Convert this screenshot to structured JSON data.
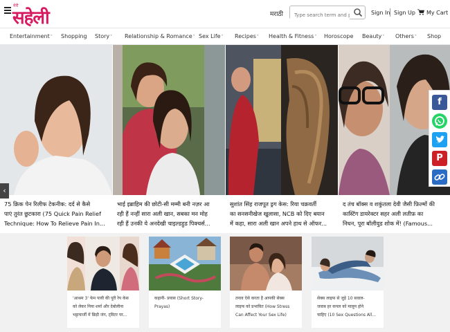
{
  "header": {
    "logo_small": "मेरी",
    "logo_main": "सहेली",
    "language": "मराठी",
    "search_placeholder": "Type search term and press enter",
    "sign_in": "Sign In",
    "sign_up": "Sign Up",
    "cart": "My Cart"
  },
  "nav": {
    "items": [
      {
        "label": "Entertainment",
        "dropdown": true
      },
      {
        "label": "Shopping",
        "dropdown": false
      },
      {
        "label": "Story",
        "dropdown": true
      },
      {
        "label": "Relationship & Romance",
        "dropdown": true
      },
      {
        "label": "Sex Life",
        "dropdown": true
      },
      {
        "label": "Recipes",
        "dropdown": true
      },
      {
        "label": "Health & Fitness",
        "dropdown": true
      },
      {
        "label": "Horoscope",
        "dropdown": false
      },
      {
        "label": "Beauty",
        "dropdown": true
      },
      {
        "label": "Others",
        "dropdown": true
      },
      {
        "label": "Shop",
        "dropdown": false
      }
    ]
  },
  "carousel": {
    "slides": [
      {
        "caption_line1": "75 क्रिक पेन रिलीफ टेकनीक: दर्द से कैसे",
        "caption_line2": "पाएं तुरंत छुटकारा (75 Quick Pain Relief",
        "caption_line3": "Technique: How To Relieve Pain In..."
      },
      {
        "caption_line1": "भाई इब्राहिम की छोटी-सी मम्मी बनी नज़र आ",
        "caption_line2": "रही हैं नन्हीं सारा अली खान, सबका मन मोह",
        "caption_line3": "रही हैं उनकी ये अनदेखी चाइल्डहुड पिक्चर्स..."
      },
      {
        "caption_line1": "सुशांत सिंह राजपूत ड्रग केस: रिया चक्रवर्ती",
        "caption_line2": "का सनसनीखेज खुलासा, NCB को दिए बयान",
        "caption_line3": "में कहा, सारा अली खान अपने हाथ से ऑफर..."
      },
      {
        "caption_line1": "द तंच बॉक्स व शकुंतला देवी जैसी फ़िल्मों की",
        "caption_line2": "कास्टिंग डायरेक्टर सहर अली लतीफ़ का",
        "caption_line3": "निधन, पूरा बॉलीवुड शोक में! (Famous..."
      }
    ],
    "prev_label": "‹"
  },
  "share": [
    "facebook-icon",
    "whatsapp-icon",
    "twitter-icon",
    "pinterest-icon",
    "link-icon"
  ],
  "colors": {
    "brand": "#d81b60",
    "facebook": "#3b5998",
    "whatsapp": "#25d366",
    "twitter": "#1da1f2",
    "pinterest": "#cb2027",
    "link": "#2a6cc4"
  },
  "cards": [
    {
      "line1": "'आश्रम 3' फेम पायी की पूरी रेप केस",
      "line2": "को लेकर निया शर्मा और देबोलीना",
      "line3": "भट्टाचार्जी में छिड़ी जंग, ट्विटर पर..."
    },
    {
      "line1": "कहानी- प्रयास (Short Story-",
      "line2": "Prayas)",
      "line3": ""
    },
    {
      "line1": "तनाव ऐसे करता है आपकी सेक्स",
      "line2": "लाइफ को प्रभावित (How Stress",
      "line3": "Can Affect Your Sex Life)"
    },
    {
      "line1": "सेक्स लाइफ से जुड़े 10 सवाल-",
      "line2": "जवाब हर कपल को मालूम होने",
      "line3": "चाहिए (10 Sex Questions All..."
    }
  ]
}
